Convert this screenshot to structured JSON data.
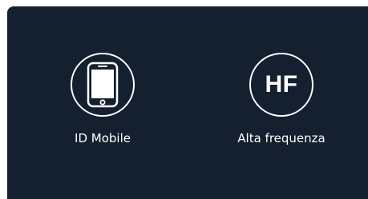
{
  "options": [
    {
      "label": "ID Mobile",
      "icon": "mobile-phone-icon"
    },
    {
      "label": "Alta frequenza",
      "icon": "hf-badge-icon",
      "badge_text": "HF"
    }
  ],
  "colors": {
    "panel_background": "#14202f",
    "foreground": "#ffffff"
  }
}
